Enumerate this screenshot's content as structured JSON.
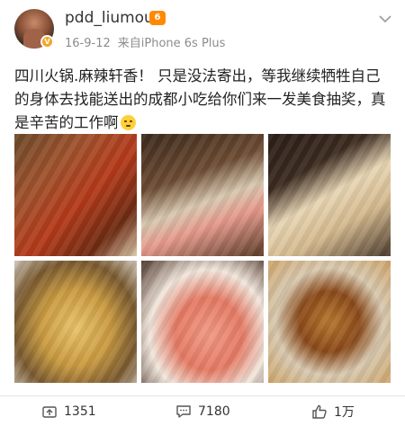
{
  "post": {
    "username": "pdd_liumou",
    "vip_badge": "6",
    "time": "16-9-12",
    "source": "来自iPhone 6s Plus",
    "text": "四川火锅.麻辣轩香！ 只是没法寄出，等我继续牺牲自己的身体去找能送出的成都小吃给你们来一发美食抽奖，真是辛苦的工作啊",
    "emoji_icon": "thinking-face-emoji"
  },
  "photos": [
    {
      "name": "hotpot-photo"
    },
    {
      "name": "buffet-meat-photo"
    },
    {
      "name": "tripe-plate-photo"
    },
    {
      "name": "noodles-photo"
    },
    {
      "name": "sliced-meat-plate-photo"
    },
    {
      "name": "dessert-bowl-photo"
    }
  ],
  "actions": {
    "repost_count": "1351",
    "comment_count": "7180",
    "like_count": "1万"
  },
  "colors": {
    "vip_badge": "#ff8a00",
    "verified": "#f5a623",
    "meta_text": "#8c8c8c"
  }
}
